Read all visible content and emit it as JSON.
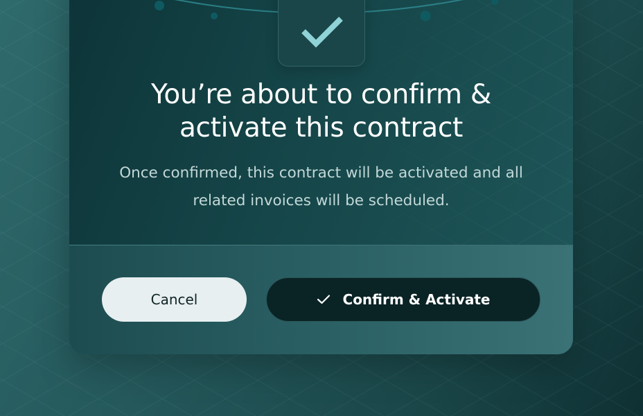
{
  "dialog": {
    "title": "You’re about to confirm & activate this contract",
    "message": "Once confirmed, this contract will be activated and all related invoices will be scheduled.",
    "icon": "checkmark-icon"
  },
  "actions": {
    "cancel_label": "Cancel",
    "confirm_label": "Confirm & Activate",
    "confirm_icon": "checkmark-icon"
  },
  "colors": {
    "accent": "#8fd3d6",
    "confirm_button_bg": "#0a2325",
    "cancel_button_bg": "#e8eff1"
  }
}
